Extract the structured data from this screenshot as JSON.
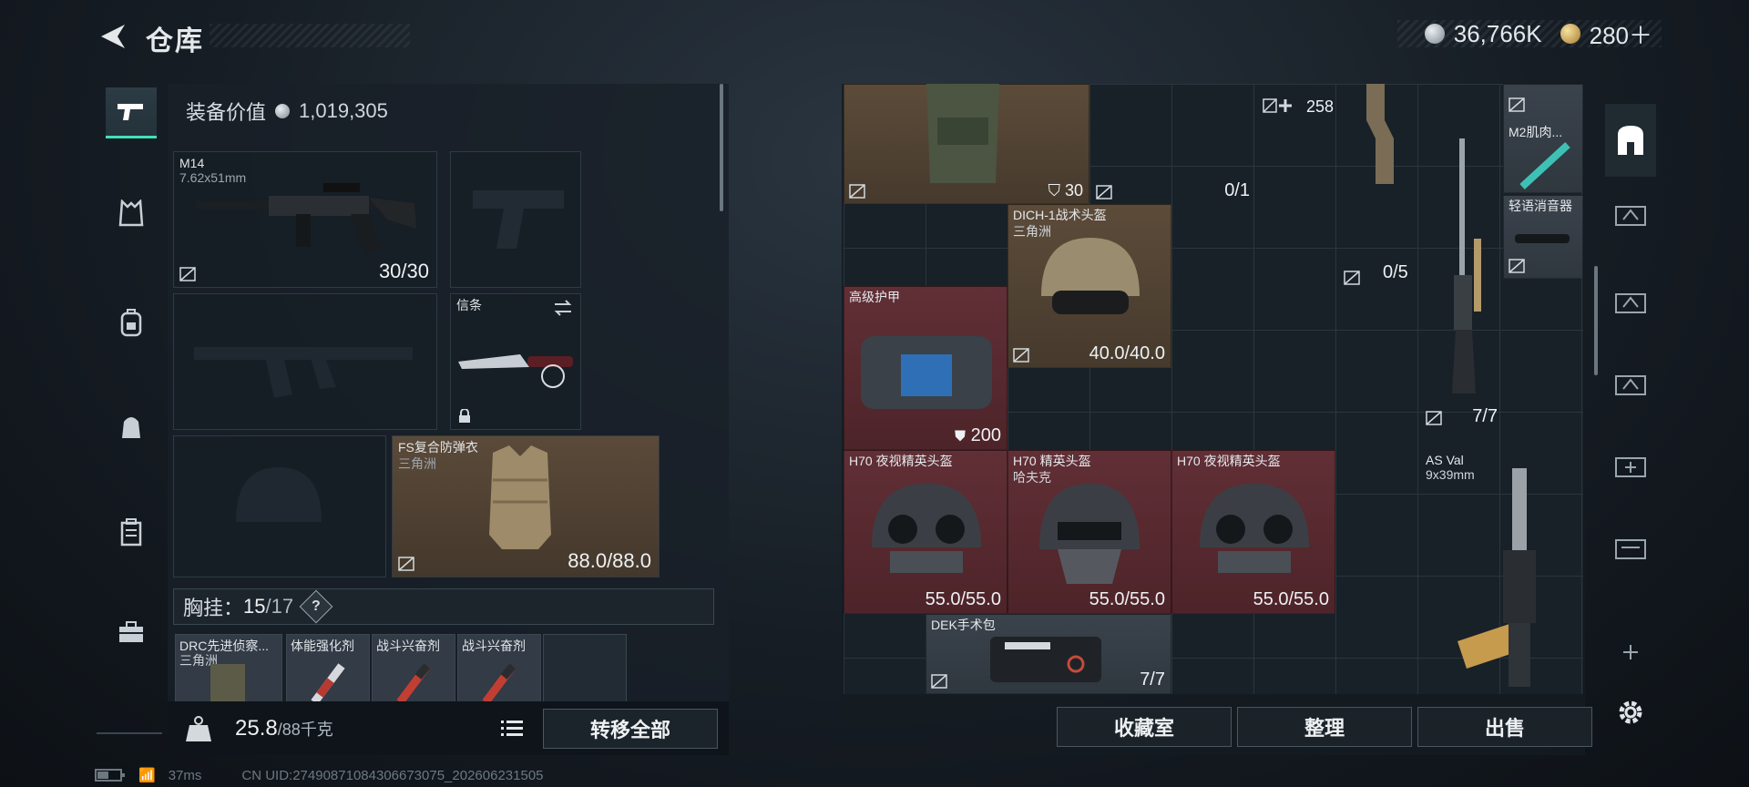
{
  "header": {
    "title": "仓库",
    "currency_silver": "36,766K",
    "currency_gold": "280＋"
  },
  "loadout": {
    "equip_value_label": "装备价值",
    "equip_value": "1,019,305",
    "primary": {
      "name": "M14",
      "caliber": "7.62x51mm",
      "ammo": "30/30"
    },
    "melee": {
      "name": "信条"
    },
    "armor": {
      "name": "FS复合防弹衣",
      "region": "三角洲",
      "durability": "88.0/88.0"
    },
    "chest_rig": {
      "label": "胸挂：",
      "used": "15",
      "capacity": "/17",
      "help": "?"
    },
    "pouches": [
      {
        "name": "DRC先进侦察...",
        "sub": "三角洲"
      },
      {
        "name": "体能强化剂",
        "sub": ""
      },
      {
        "name": "战斗兴奋剂",
        "sub": ""
      },
      {
        "name": "战斗兴奋剂",
        "sub": ""
      }
    ],
    "weight": "25.8",
    "weight_unit": "/88千克",
    "transfer_all": "转移全部"
  },
  "stash": {
    "items": [
      {
        "id": "vest",
        "name": "",
        "sub": "",
        "stat": ""
      },
      {
        "id": "ammo30",
        "stat": "30"
      },
      {
        "id": "slot01",
        "stat": "0/1"
      },
      {
        "id": "ammo258",
        "stat": "258"
      },
      {
        "id": "m2",
        "name": "M2肌肉..."
      },
      {
        "id": "silencer",
        "name": "轻语消音器"
      },
      {
        "id": "dich",
        "name": "DICH-1战术头盔",
        "sub": "三角洲",
        "stat": "40.0/40.0"
      },
      {
        "id": "slot05",
        "stat": "0/5"
      },
      {
        "id": "hiarmor",
        "name": "高级护甲",
        "stat": "200"
      },
      {
        "id": "rifle77",
        "stat": "7/7"
      },
      {
        "id": "h70a",
        "name": "H70 夜视精英头盔",
        "stat": "55.0/55.0"
      },
      {
        "id": "h70b",
        "name": "H70 精英头盔",
        "sub": "哈夫克",
        "stat": "55.0/55.0"
      },
      {
        "id": "h70c",
        "name": "H70 夜视精英头盔",
        "stat": "55.0/55.0"
      },
      {
        "id": "asval",
        "name": "AS Val",
        "sub": "9x39mm"
      },
      {
        "id": "dek",
        "name": "DEK手术包",
        "stat": "7/7"
      }
    ],
    "actions": {
      "collection": "收藏室",
      "organize": "整理",
      "sell": "出售"
    }
  },
  "status": {
    "ping": "37ms",
    "uid": "CN UID:27490871084306673075_202606231505"
  },
  "colors": {
    "accent": "#3fe1b8",
    "brown_cell": "#5b4a39",
    "red_cell": "#612f36"
  }
}
